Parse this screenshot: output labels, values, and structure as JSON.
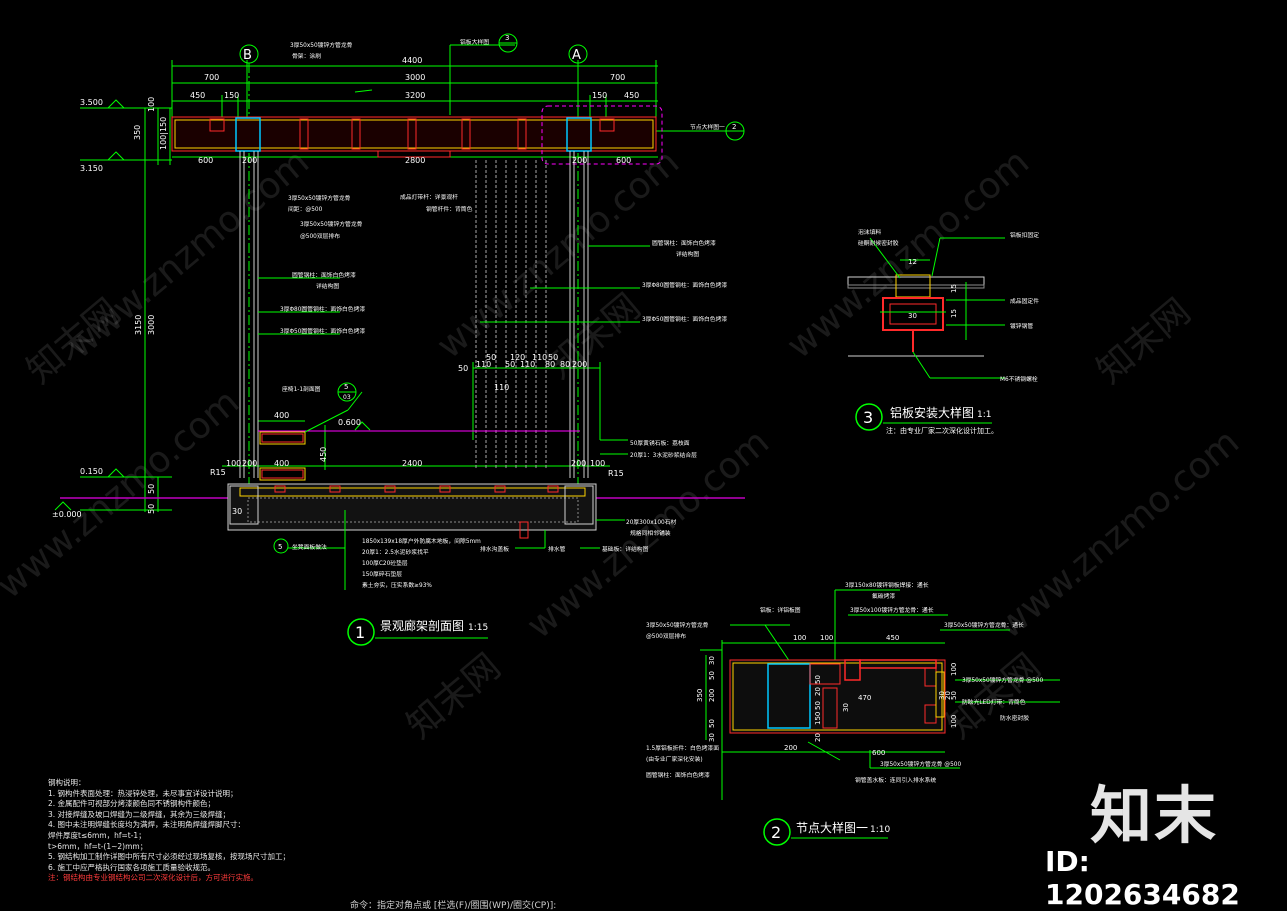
{
  "titles": {
    "t1": "景观廊架剖面图",
    "s1": "1:15",
    "n1": "1",
    "t2": "节点大样图一",
    "s2": "1:10",
    "n2": "2",
    "t3": "铝板安装大样图",
    "s3": "1:1",
    "n3": "3",
    "t3_note": "注：由专业厂家二次深化设计加工。"
  },
  "grid": {
    "B": "B",
    "A": "A"
  },
  "dims": {
    "top_total": "4400",
    "top_700a": "700",
    "top_3000": "3000",
    "top_700b": "700",
    "top_450a": "450",
    "top_150a": "150",
    "top_3200": "3200",
    "top_150b": "150",
    "top_450b": "450",
    "bot_600a": "600",
    "bot_200a": "200",
    "bot_2800": "2800",
    "bot_200b": "200",
    "bot_600b": "600",
    "v_100": "100",
    "v_350": "350",
    "v_100_150": "100|150",
    "v_3150": "3150",
    "v_3000": "3000",
    "v_450": "450",
    "v_50a": "50",
    "v_50b": "50",
    "lvl_3500": "3.500",
    "lvl_3150": "3.150",
    "lvl_0150": "0.150",
    "lvl_0000": "±0.000",
    "lvl_0600": "0.600",
    "seat_400a": "400",
    "seat_400b": "400",
    "base_100a": "100",
    "base_200a": "200",
    "base_2400": "2400",
    "base_200b": "200",
    "base_100b": "100",
    "r15a": "R15",
    "r15b": "R15",
    "d30": "30",
    "mid_50a": "50",
    "mid_120": "120",
    "mid_110a": "110",
    "mid_50b": "50",
    "mid_110b": "110",
    "mid_110c": "110",
    "mid_50c": "50",
    "mid_80a": "80",
    "mid_80b": "80",
    "mid_200": "200",
    "mid_50d": "50",
    "mid_110d": "110",
    "n3_12": "12",
    "n3_15a": "15",
    "n3_15b": "15",
    "n3_30": "30",
    "n2_100a": "100",
    "n2_100b": "100",
    "n2_450": "450",
    "n2_350": "350",
    "n2_200": "200",
    "n2_30a": "30",
    "n2_50a": "50",
    "n2_50b": "50",
    "n2_30b": "30",
    "n2_50c": "50",
    "n2_50d": "50",
    "n2_20a": "20",
    "n2_20b": "20",
    "n2_150": "150",
    "n2_30c": "30",
    "n2_470": "470",
    "n2_200b": "200",
    "n2_600": "600",
    "n2_100c": "100",
    "n2_100d": "100",
    "n2_50e": "50",
    "n2_30d": "30",
    "n2_20c": "20"
  },
  "labels": {
    "top_beam": "3厚50x50镀锌方管龙骨",
    "top_beam2": "骨架：涂刷",
    "ref3": "铝板大样图",
    "ref3_num": "3",
    "node_ref": "节点大样图一",
    "node_ref_num": "2",
    "mid_tube1": "3厚50x50镀锌方管龙骨",
    "mid_tube2": "间距：@500",
    "mid_tube3": "3厚50x50镀锌方管龙骨",
    "mid_tube4": "@500双层排布",
    "light1": "成品灯带杆：详景观杆",
    "light2": "钢管杆件：背筒色",
    "col_r1": "圆管钢柱：面饰白色烤漆",
    "col_r2": "详结构图",
    "col_r3": "3厚Φ80圆管钢柱：面饰白色烤漆",
    "col_r4": "3厚Φ50圆管钢柱：面饰白色烤漆",
    "col_l1": "圆管钢柱：面饰白色烤漆",
    "col_l2": "详结构图",
    "col_l3": "3厚Φ80圆管钢柱：面饰白色烤漆",
    "col_l4": "3厚Φ50圆管钢柱：面饰白色烤漆",
    "seat_ref": "座椅1-1剖面图",
    "seat_ref_num": "5",
    "seat_ref_sub": "03",
    "base_r1": "50厚黄锈石板：荔枝面",
    "base_r2": "20厚1：3水泥砂浆结合层",
    "base_r3": "20厚300x100石材",
    "base_r4": "规格同相邻铺装",
    "base_b1": "1850x139x18厚户外防腐木地板，间隙5mm",
    "base_b2": "20厚1：2.5水泥砂浆找平",
    "base_b3": "100厚C20砼垫层",
    "base_b4": "150厚碎石垫层",
    "base_b5": "素土夯实，压实系数≥93%",
    "base_b6": "排水沟盖板",
    "base_b7": "排水管",
    "base_b8": "基础板：详结构图",
    "base_ref_num": "5",
    "base_ref_txt": "坐凳面板做法",
    "n3_l1": "泡沫填料",
    "n3_l2": "硅酮耐候密封胶",
    "n3_r1": "铝板扣固定",
    "n3_r2": "成品固定件",
    "n3_r3": "镀锌钢管",
    "n3_r4": "M6不锈钢螺栓",
    "n2_t1": "3厚150x80镀锌钢板焊接：通长",
    "n2_t2": "氟碳烤漆",
    "n2_t3": "3厚50x100镀锌方管龙骨：通长",
    "n2_t4": "3厚50x50镀锌方管龙骨：通长",
    "n2_l1": "铝板：详铝板图",
    "n2_l2": "3厚50x50镀锌方管龙骨",
    "n2_l3": "@500双层排布",
    "n2_r1": "3厚50x50镀锌方管龙骨 @500",
    "n2_r2": "防眩光LED灯带：背筒色",
    "n2_r3": "防水密封胶",
    "n2_b1": "1.5厚铝板折件：白色烤漆面",
    "n2_b2": "(由专业厂家深化安装)",
    "n2_b3": "圆管钢柱：面饰白色烤漆",
    "n2_b4": "3厚50x50镀锌方管龙骨 @500",
    "n2_b5": "钢管盖水板：连同引入排水系统"
  },
  "notes": [
    "钢构说明：",
    "1. 钢构件表面处理：热浸锌处理，未尽事宜详设计说明；",
    "2. 金属配件可视部分烤漆颜色同不锈钢构件颜色；",
    "3. 对接焊缝及坡口焊缝为二级焊缝，其余为三级焊缝；",
    "4. 图中未注明焊缝长度均为满焊，未注明角焊缝焊脚尺寸：",
    "   焊件厚度t≤6mm，hf=t-1；",
    "   t>6mm，hf=t-(1~2)mm；",
    "5. 钢结构加工制作详图中所有尺寸必须经过现场复核，按现场尺寸加工；",
    "6. 施工中应严格执行国家各项施工质量验收规范。"
  ],
  "note_red": "注：钢结构由专业钢结构公司二次深化设计后，方可进行实施。",
  "status_bar": "命令：指定对角点或 [栏选(F)/圈围(WP)/圈交(CP)]:",
  "watermark": {
    "text": "www.znzmo.com",
    "logo": "知末网"
  },
  "brand": "知末",
  "image_id": "ID: 1202634682",
  "colors": {
    "bg": "#000000",
    "dim": "#00ff00",
    "text": "#ffffff",
    "steel": "#ff2a2a",
    "outline": "#ffd400",
    "blue": "#00c8ff",
    "hatch": "#d0d0d0",
    "grade": "#c000c0",
    "magenta": "#ff00ff"
  }
}
